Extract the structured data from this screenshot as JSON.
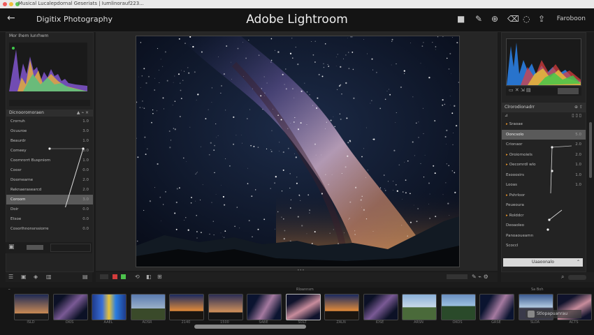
{
  "os_title": "Musical Lucalepdornal Geseriats | Iumlinorauf223...",
  "header": {
    "brand": "Digitix Photography",
    "title": "Adobe Lightroom",
    "user": "Faroboon"
  },
  "left_panel": {
    "histogram_label": "Mor Ihem Iunrhwm",
    "section_title": "Dicnooromoraen",
    "rows": [
      {
        "label": "Crorruh",
        "value": "1.0"
      },
      {
        "label": "Ocuuroe",
        "value": "3.0"
      },
      {
        "label": "Beaurdr",
        "value": "1.0"
      },
      {
        "label": "Comeey",
        "value": "0.0"
      },
      {
        "label": "Coomrorrt Buspniom",
        "value": "1.0"
      },
      {
        "label": "Coosr",
        "value": "0.0"
      },
      {
        "label": "Doomearne",
        "value": "2.0"
      },
      {
        "label": "Reknaerasearcd",
        "value": "2.0"
      },
      {
        "label": "Coroom",
        "value": "3.0"
      },
      {
        "label": "Doir",
        "value": "0.0"
      },
      {
        "label": "Etsoe",
        "value": "0.0"
      },
      {
        "label": "Cosorlhnonsrssiorre",
        "value": "0.0"
      }
    ]
  },
  "right_panel": {
    "section_title": "Clrorodionadrr",
    "rows": [
      {
        "label": "Sraoae",
        "value": ""
      },
      {
        "label": "Ooncsolo",
        "value": "5.0"
      },
      {
        "label": "Crionaor",
        "value": "2.0"
      },
      {
        "label": "Oroiornoiels",
        "value": "2.0"
      },
      {
        "label": "Oecomrdl wlo",
        "value": "1.0"
      },
      {
        "label": "Esooosirs",
        "value": "1.0"
      },
      {
        "label": "Looas",
        "value": "1.0"
      },
      {
        "label": "Pshrloor",
        "value": ""
      },
      {
        "label": "Peueoura",
        "value": ""
      },
      {
        "label": "Rolddcr",
        "value": ""
      },
      {
        "label": "Deoaoleo",
        "value": ""
      },
      {
        "label": "Panoaoueamn",
        "value": ""
      },
      {
        "label": "Scoccl",
        "value": ""
      }
    ],
    "dropdown": "Uaaoonalo"
  },
  "filmstrip": {
    "label": "Rloannsm",
    "zoom": "Sa Boh",
    "watermark": "Stlopapuanrau",
    "thumbs": [
      {
        "caption": "ISLD",
        "theme": "dusk"
      },
      {
        "caption": "OKIS",
        "theme": "milky"
      },
      {
        "caption": "AAEL",
        "theme": "hist"
      },
      {
        "caption": "ADSR",
        "theme": "land"
      },
      {
        "caption": "2140",
        "theme": "sunset"
      },
      {
        "caption": "1500",
        "theme": "dusk2"
      },
      {
        "caption": "SABE",
        "theme": "milky2"
      },
      {
        "caption": "SOLT",
        "theme": "milky3"
      },
      {
        "caption": "ZALN",
        "theme": "sunset"
      },
      {
        "caption": "IDSE",
        "theme": "milky"
      },
      {
        "caption": "ARSN",
        "theme": "road"
      },
      {
        "caption": "OKOS",
        "theme": "forest"
      },
      {
        "caption": "GRSE",
        "theme": "milky2"
      },
      {
        "caption": "SLOA",
        "theme": "mountain"
      },
      {
        "caption": "ACTS",
        "theme": "milky3"
      }
    ]
  },
  "colors": {
    "accent": "#e0902a",
    "selected": "#5a5a5a"
  }
}
